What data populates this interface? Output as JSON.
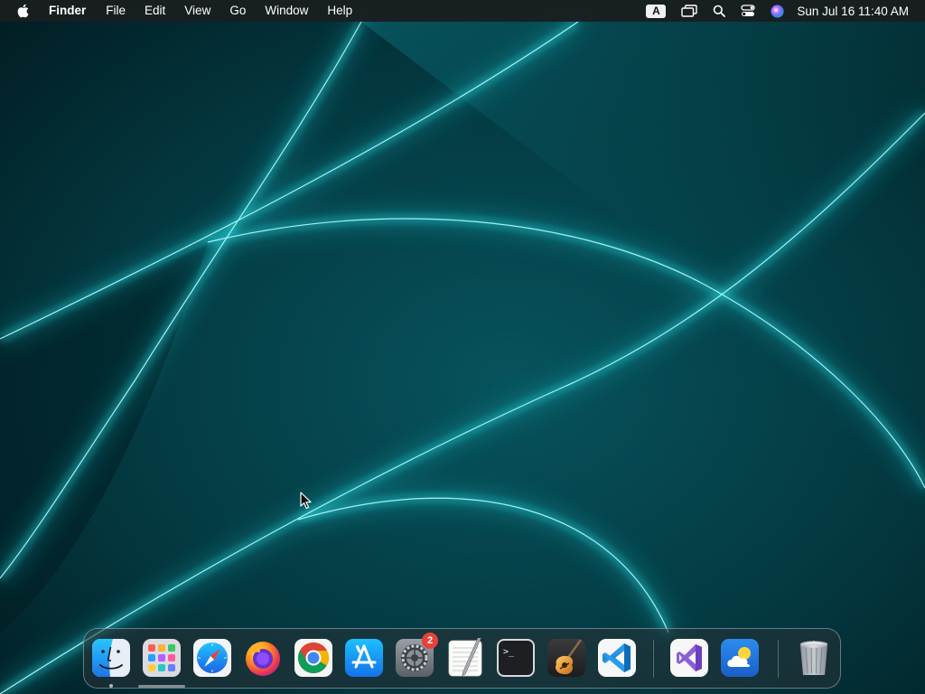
{
  "menubar": {
    "app_name": "Finder",
    "menus": [
      "File",
      "Edit",
      "View",
      "Go",
      "Window",
      "Help"
    ],
    "input_source": "A",
    "clock": "Sun Jul 16  11:40 AM",
    "status_icons": [
      "input-source-icon",
      "screen-mirroring-icon",
      "spotlight-search-icon",
      "control-center-icon",
      "siri-icon"
    ]
  },
  "dock": {
    "apps": [
      {
        "name": "finder",
        "running": true
      },
      {
        "name": "launchpad",
        "running": false
      },
      {
        "name": "safari",
        "running": false
      },
      {
        "name": "firefox",
        "running": false
      },
      {
        "name": "chrome",
        "running": false
      },
      {
        "name": "app-store",
        "running": false
      },
      {
        "name": "system-settings",
        "running": false,
        "badge": "2"
      },
      {
        "name": "textedit",
        "running": false
      },
      {
        "name": "terminal",
        "running": false
      },
      {
        "name": "garageband",
        "running": false
      },
      {
        "name": "vscode",
        "running": false
      },
      {
        "name": "visual-studio",
        "running": false
      },
      {
        "name": "weather",
        "running": false
      },
      {
        "name": "trash",
        "running": false
      }
    ],
    "terminal_prompt": ">_",
    "system_settings_badge": "2"
  },
  "colors": {
    "wallpaper_dark": "#02262c",
    "wallpaper_glow": "#22e6f0",
    "menubar_bg": "#1a1e20",
    "badge_red": "#e8403a"
  }
}
